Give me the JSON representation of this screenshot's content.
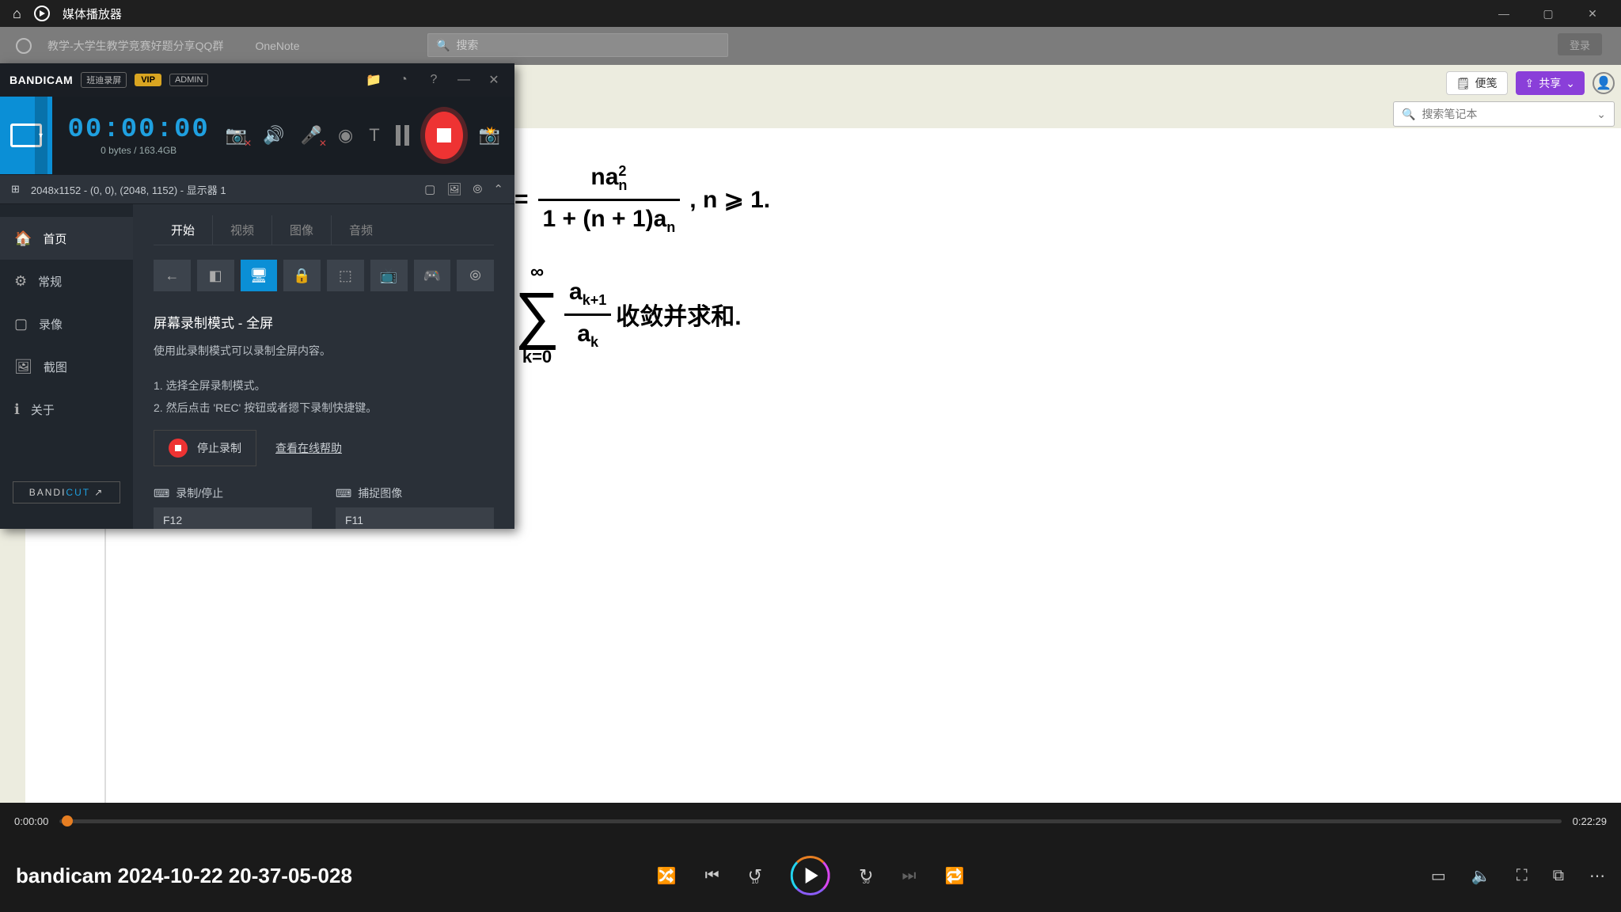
{
  "titlebar": {
    "app_name": "媒体播放器"
  },
  "faded": {
    "tab1": "教学-大学生教学竞赛好题分享QQ群",
    "tab2": "OneNote",
    "search_placeholder": "搜索",
    "login": "登录"
  },
  "onenote": {
    "note_btn": "便笺",
    "share_btn": "共享",
    "search_placeholder": "搜索笔记本"
  },
  "math": {
    "line1_lhs": "=",
    "frac1_num_a": "na",
    "frac1_num_sub": "n",
    "frac1_num_sup": "2",
    "frac1_den": "1 + (n + 1)a",
    "frac1_den_sub": "n",
    "line1_tail": ", n ⩾ 1.",
    "sigma_top": "∞",
    "sigma_bot": "k=0",
    "frac2_num": "a",
    "frac2_num_sub": "k+1",
    "frac2_den": "a",
    "frac2_den_sub": "k",
    "sum_tail": "收敛并求和."
  },
  "bandicam": {
    "logo": "BANDICAM",
    "tag": "班迪录屏",
    "vip": "VIP",
    "admin": "ADMIN",
    "timer": "00:00:00",
    "size": "0 bytes / 163.4GB",
    "status": "2048x1152 - (0, 0), (2048, 1152) - 显示器 1",
    "sidebar": {
      "home": "首页",
      "general": "常规",
      "video": "录像",
      "image": "截图",
      "about": "关于",
      "bandicut": "BANDI",
      "bandicut2": "CUT"
    },
    "tabs": {
      "start": "开始",
      "video": "视频",
      "image": "图像",
      "audio": "音频"
    },
    "mode_title": "屏幕录制模式 - 全屏",
    "mode_desc": "使用此录制模式可以录制全屏内容。",
    "step1": "1. 选择全屏录制模式。",
    "step2": "2. 然后点击 'REC' 按钮或者摁下录制快捷键。",
    "stop_label": "停止录制",
    "help_link": "查看在线帮助",
    "hotkey1_label": "录制/停止",
    "hotkey1_value": "F12",
    "hotkey2_label": "捕捉图像",
    "hotkey2_value": "F11"
  },
  "player": {
    "current": "0:00:00",
    "total": "0:22:29",
    "title": "bandicam 2024-10-22 20-37-05-028",
    "skip_back": "10",
    "skip_fwd": "30"
  }
}
